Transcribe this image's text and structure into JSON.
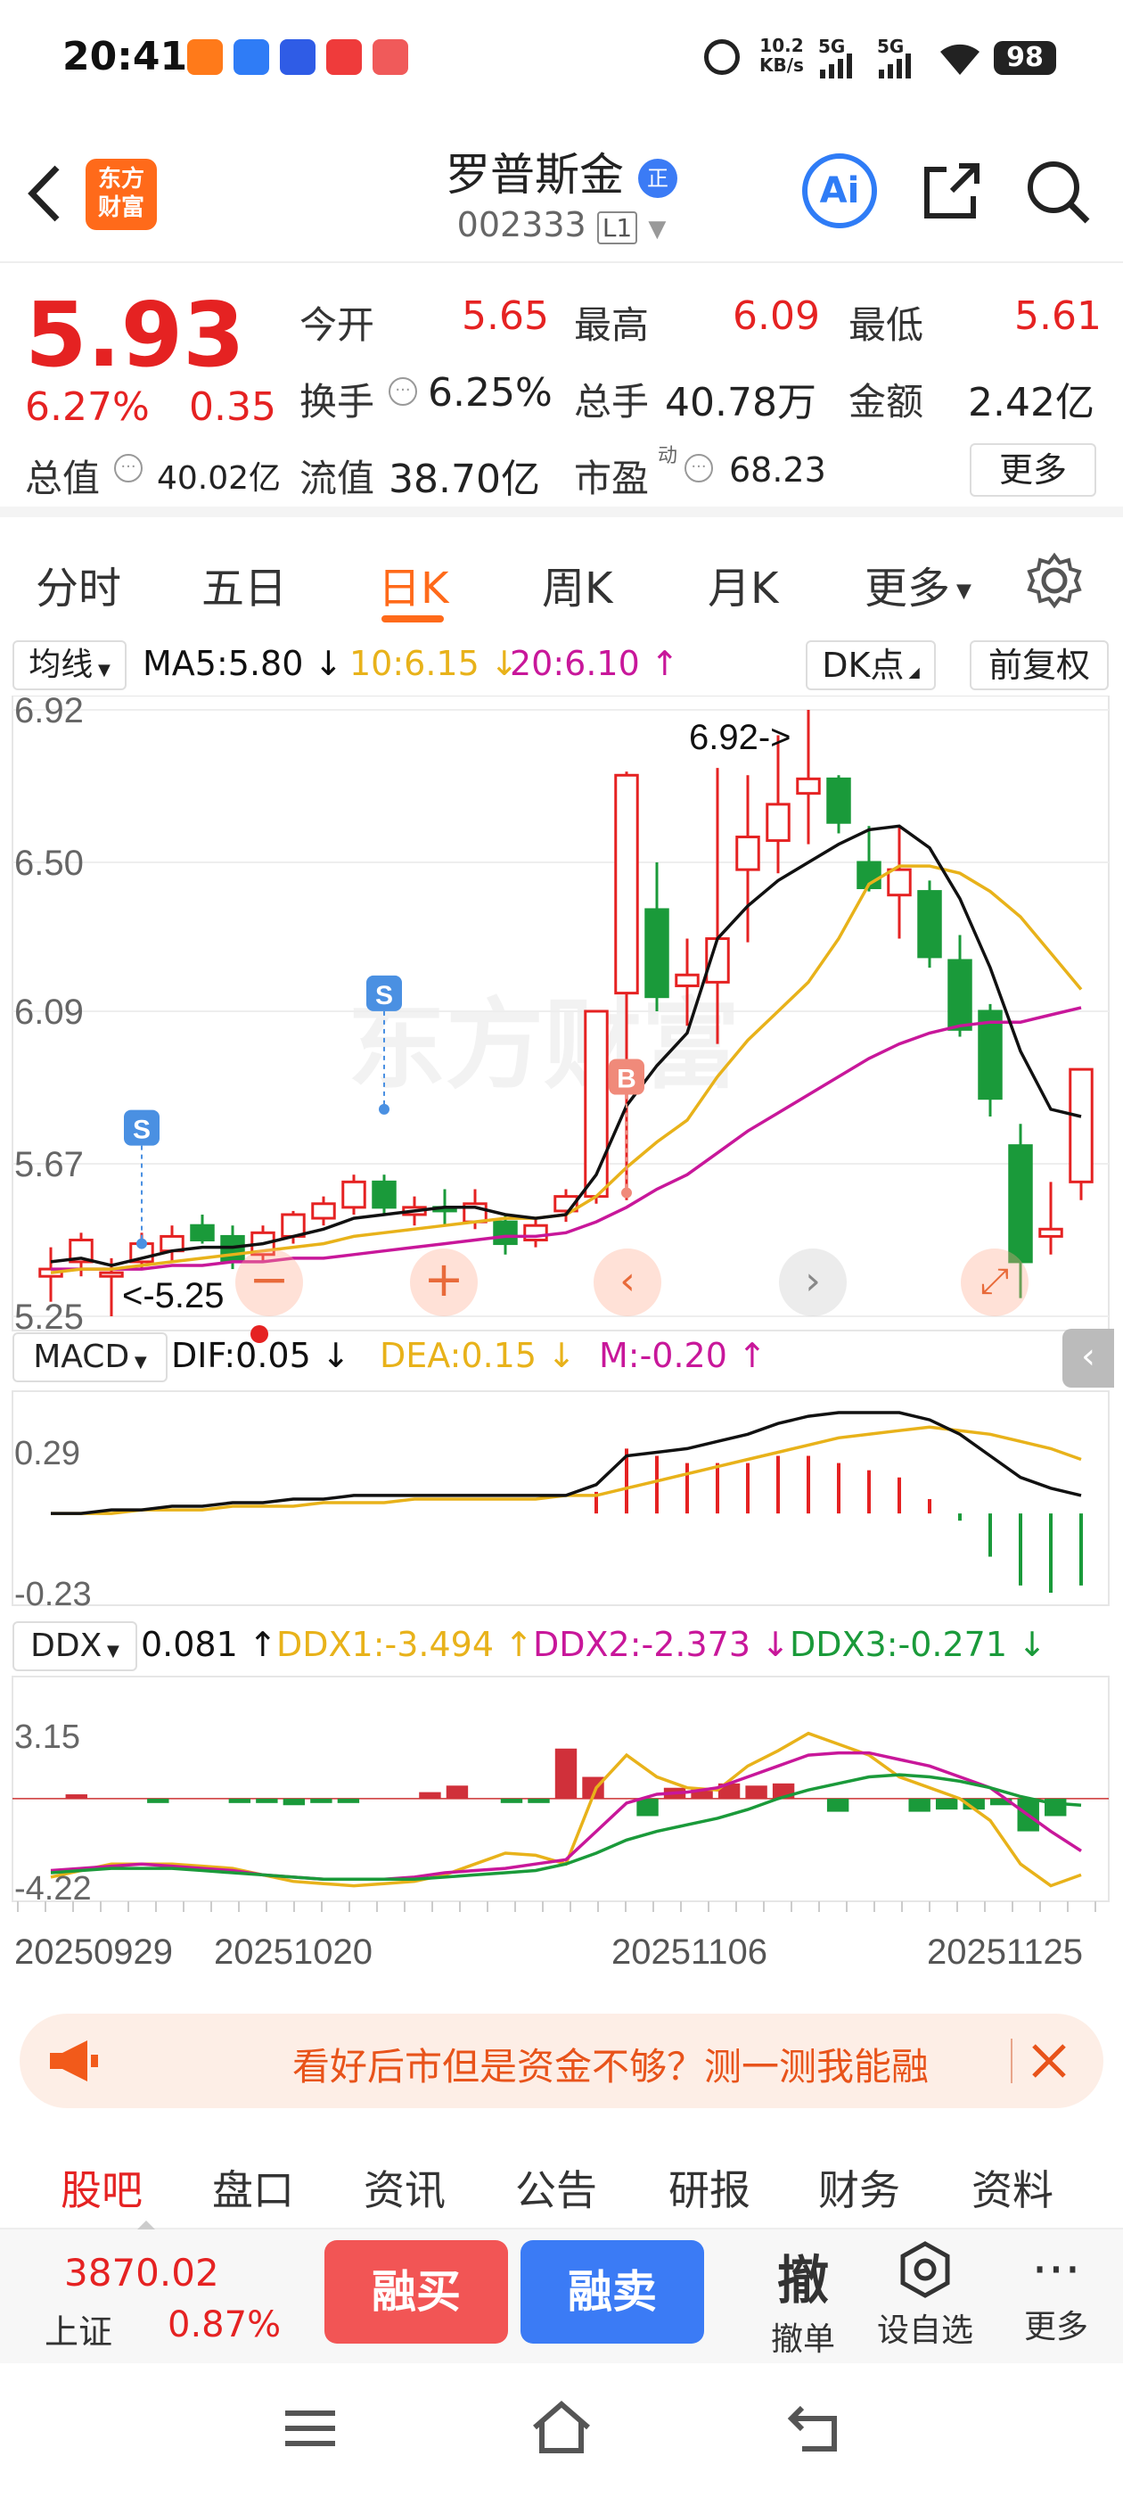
{
  "status_bar": {
    "time": "20:41",
    "network_speed_top": "10.2",
    "network_speed_unit": "KB/s",
    "signal1": "5G",
    "signal2": "5G",
    "battery": "98"
  },
  "header": {
    "logo_line1": "东方",
    "logo_line2": "财富",
    "stock_name": "罗普斯金",
    "badge": "正",
    "stock_code": "002333",
    "level": "L1",
    "ai_label": "Ai"
  },
  "quote": {
    "price": "5.93",
    "change_pct": "6.27%",
    "change_amt": "0.35",
    "open_label": "今开",
    "open": "5.65",
    "high_label": "最高",
    "high": "6.09",
    "low_label": "最低",
    "low": "5.61",
    "turnover_label": "换手",
    "turnover": "6.25%",
    "volume_label": "总手",
    "volume": "40.78万",
    "amount_label": "金额",
    "amount": "2.42亿",
    "mktcap_label": "总值",
    "mktcap": "40.02亿",
    "float_label": "流值",
    "float": "38.70亿",
    "pe_label": "市盈",
    "pe_sup": "动",
    "pe": "68.23",
    "more": "更多"
  },
  "period_tabs": [
    "分时",
    "五日",
    "日K",
    "周K",
    "月K",
    "更多"
  ],
  "active_tab": "日K",
  "kline": {
    "ma_label": "均线",
    "ma5": "MA5:5.80 ↓",
    "ma10": "10:6.15 ↓",
    "ma20": "20:6.10 ↑",
    "dk_btn": "DK点",
    "adjust_btn": "前复权",
    "y_labels": [
      "6.92",
      "6.50",
      "6.09",
      "5.67",
      "5.25"
    ],
    "max_annot": "6.92->",
    "min_annot": "<-5.25",
    "watermark": "东方财富",
    "signal_s": "S",
    "signal_b": "B"
  },
  "macd": {
    "label": "MACD",
    "dif": "DIF:0.05 ↓",
    "dea": "DEA:0.15 ↓",
    "m": "M:-0.20 ↑",
    "y_top": "0.29",
    "y_bottom": "-0.23"
  },
  "ddx": {
    "label": "DDX",
    "ddx": "0.081 ↑",
    "ddx1": "DDX1:-3.494 ↑",
    "ddx2": "DDX2:-2.373 ↓",
    "ddx3": "DDX3:-0.271 ↓",
    "y_top": "3.15",
    "y_bottom": "-4.22"
  },
  "dates": [
    "20250929",
    "20251020",
    "20251106",
    "20251125"
  ],
  "banner": {
    "text": "看好后市但是资金不够？测一测我能融"
  },
  "bottom_tabs": [
    "股吧",
    "盘口",
    "资讯",
    "公告",
    "研报",
    "财务",
    "资料"
  ],
  "active_bottom_tab": "股吧",
  "toolbar": {
    "index_value": "3870.02",
    "index_name": "上证",
    "index_change": "0.87%",
    "buy": "融买",
    "sell": "融卖",
    "cancel_icon_char": "撤",
    "cancel_label": "撤单",
    "watch_label": "设自选",
    "more_label": "更多"
  },
  "colors": {
    "up": "#e52222",
    "down": "#1a9a3a",
    "ma5": "#111111",
    "ma10": "#e8b21a",
    "ma20": "#c8179a",
    "accent": "#ff6a1a",
    "blue": "#3b7bf5"
  },
  "chart_data": {
    "type": "candlestick",
    "y_range": [
      5.25,
      6.92
    ],
    "candles": [
      {
        "o": 5.36,
        "h": 5.44,
        "l": 5.29,
        "c": 5.38
      },
      {
        "o": 5.4,
        "h": 5.48,
        "l": 5.36,
        "c": 5.46
      },
      {
        "o": 5.36,
        "h": 5.41,
        "l": 5.25,
        "c": 5.37
      },
      {
        "o": 5.4,
        "h": 5.48,
        "l": 5.38,
        "c": 5.45
      },
      {
        "o": 5.43,
        "h": 5.5,
        "l": 5.4,
        "c": 5.47
      },
      {
        "o": 5.5,
        "h": 5.53,
        "l": 5.45,
        "c": 5.46
      },
      {
        "o": 5.47,
        "h": 5.5,
        "l": 5.38,
        "c": 5.4
      },
      {
        "o": 5.42,
        "h": 5.5,
        "l": 5.4,
        "c": 5.48
      },
      {
        "o": 5.47,
        "h": 5.54,
        "l": 5.45,
        "c": 5.53
      },
      {
        "o": 5.52,
        "h": 5.58,
        "l": 5.5,
        "c": 5.56
      },
      {
        "o": 5.55,
        "h": 5.64,
        "l": 5.53,
        "c": 5.62
      },
      {
        "o": 5.62,
        "h": 5.64,
        "l": 5.53,
        "c": 5.55
      },
      {
        "o": 5.53,
        "h": 5.58,
        "l": 5.5,
        "c": 5.55
      },
      {
        "o": 5.55,
        "h": 5.6,
        "l": 5.5,
        "c": 5.54
      },
      {
        "o": 5.51,
        "h": 5.6,
        "l": 5.49,
        "c": 5.56
      },
      {
        "o": 5.51,
        "h": 5.53,
        "l": 5.42,
        "c": 5.45
      },
      {
        "o": 5.46,
        "h": 5.52,
        "l": 5.44,
        "c": 5.5
      },
      {
        "o": 5.54,
        "h": 5.6,
        "l": 5.51,
        "c": 5.58
      },
      {
        "o": 5.58,
        "h": 6.09,
        "l": 5.56,
        "c": 6.09
      },
      {
        "o": 6.14,
        "h": 6.75,
        "l": 5.57,
        "c": 6.74
      },
      {
        "o": 6.37,
        "h": 6.5,
        "l": 6.09,
        "c": 6.13
      },
      {
        "o": 6.16,
        "h": 6.29,
        "l": 6.05,
        "c": 6.19
      },
      {
        "o": 6.17,
        "h": 6.76,
        "l": 6.0,
        "c": 6.29
      },
      {
        "o": 6.48,
        "h": 6.74,
        "l": 6.28,
        "c": 6.57
      },
      {
        "o": 6.56,
        "h": 6.85,
        "l": 6.47,
        "c": 6.66
      },
      {
        "o": 6.69,
        "h": 6.92,
        "l": 6.55,
        "c": 6.73
      },
      {
        "o": 6.73,
        "h": 6.74,
        "l": 6.58,
        "c": 6.61
      },
      {
        "o": 6.5,
        "h": 6.6,
        "l": 6.42,
        "c": 6.43
      },
      {
        "o": 6.41,
        "h": 6.6,
        "l": 6.29,
        "c": 6.48
      },
      {
        "o": 6.42,
        "h": 6.45,
        "l": 6.21,
        "c": 6.24
      },
      {
        "o": 6.23,
        "h": 6.3,
        "l": 6.02,
        "c": 6.04
      },
      {
        "o": 6.09,
        "h": 6.11,
        "l": 5.8,
        "c": 5.85
      },
      {
        "o": 5.72,
        "h": 5.78,
        "l": 5.3,
        "c": 5.4
      },
      {
        "o": 5.47,
        "h": 5.62,
        "l": 5.42,
        "c": 5.49
      },
      {
        "o": 5.62,
        "h": 5.82,
        "l": 5.57,
        "c": 5.93
      }
    ],
    "ma5": [
      5.4,
      5.41,
      5.39,
      5.41,
      5.43,
      5.44,
      5.44,
      5.45,
      5.47,
      5.49,
      5.52,
      5.53,
      5.54,
      5.55,
      5.55,
      5.53,
      5.52,
      5.53,
      5.64,
      5.83,
      5.94,
      6.03,
      6.29,
      6.38,
      6.45,
      6.5,
      6.55,
      6.59,
      6.6,
      6.54,
      6.4,
      6.21,
      5.98,
      5.82,
      5.8
    ],
    "ma10": [
      5.37,
      5.38,
      5.38,
      5.39,
      5.4,
      5.41,
      5.42,
      5.43,
      5.44,
      5.45,
      5.47,
      5.48,
      5.49,
      5.5,
      5.51,
      5.52,
      5.52,
      5.53,
      5.58,
      5.66,
      5.73,
      5.79,
      5.91,
      6.01,
      6.09,
      6.17,
      6.29,
      6.44,
      6.49,
      6.49,
      6.47,
      6.42,
      6.35,
      6.25,
      6.15
    ],
    "ma20": [
      5.38,
      5.38,
      5.38,
      5.38,
      5.39,
      5.39,
      5.4,
      5.4,
      5.41,
      5.41,
      5.42,
      5.43,
      5.44,
      5.45,
      5.46,
      5.47,
      5.47,
      5.48,
      5.51,
      5.55,
      5.6,
      5.64,
      5.7,
      5.76,
      5.81,
      5.86,
      5.91,
      5.96,
      6.0,
      6.03,
      6.05,
      6.06,
      6.06,
      6.08,
      6.1
    ],
    "macd_range": [
      -0.23,
      0.29
    ],
    "dif": [
      0.0,
      0.0,
      0.01,
      0.01,
      0.02,
      0.02,
      0.03,
      0.03,
      0.04,
      0.04,
      0.05,
      0.05,
      0.05,
      0.05,
      0.05,
      0.05,
      0.05,
      0.05,
      0.08,
      0.16,
      0.17,
      0.18,
      0.2,
      0.22,
      0.25,
      0.27,
      0.28,
      0.28,
      0.28,
      0.26,
      0.22,
      0.16,
      0.1,
      0.07,
      0.05
    ],
    "dea": [
      0.0,
      0.0,
      0.0,
      0.01,
      0.01,
      0.01,
      0.02,
      0.02,
      0.02,
      0.03,
      0.03,
      0.03,
      0.04,
      0.04,
      0.04,
      0.04,
      0.04,
      0.05,
      0.05,
      0.07,
      0.09,
      0.11,
      0.13,
      0.15,
      0.17,
      0.19,
      0.21,
      0.22,
      0.23,
      0.24,
      0.23,
      0.22,
      0.2,
      0.18,
      0.15
    ],
    "m": [
      0.0,
      0.0,
      0.0,
      0.0,
      0.0,
      0.0,
      0.0,
      0.0,
      0.0,
      0.0,
      0.0,
      0.0,
      0.0,
      0.0,
      0.0,
      0.0,
      0.0,
      0.0,
      0.06,
      0.18,
      0.16,
      0.14,
      0.14,
      0.14,
      0.16,
      0.16,
      0.14,
      0.12,
      0.1,
      0.04,
      -0.02,
      -0.12,
      -0.2,
      -0.22,
      -0.2
    ],
    "ddx_range": [
      -4.22,
      3.15
    ],
    "ddx_bars": [
      0.0,
      0.2,
      0.0,
      0.0,
      -0.2,
      0.0,
      0.0,
      -0.2,
      -0.2,
      -0.3,
      -0.2,
      -0.2,
      0.0,
      0.0,
      0.3,
      0.6,
      0.0,
      -0.2,
      -0.2,
      2.3,
      1.0,
      0.0,
      -0.8,
      0.5,
      0.5,
      0.7,
      0.6,
      0.7,
      0.0,
      -0.6,
      0.0,
      0.0,
      -0.6,
      -0.5,
      -0.5,
      -0.3,
      -1.5,
      -0.8,
      0.0
    ],
    "ddx1": [
      -3.6,
      -3.3,
      -3.0,
      -3.0,
      -3.0,
      -3.1,
      -3.2,
      -3.5,
      -3.8,
      -3.9,
      -4.0,
      -3.9,
      -3.8,
      -3.5,
      -3.0,
      -2.5,
      -2.6,
      -3.0,
      0.5,
      2.0,
      1.0,
      0.5,
      0.4,
      1.5,
      2.2,
      3.0,
      2.5,
      2.0,
      1.0,
      0.5,
      0.0,
      -1.0,
      -3.0,
      -4.0,
      -3.5
    ],
    "ddx2": [
      -3.3,
      -3.2,
      -3.1,
      -3.0,
      -3.1,
      -3.2,
      -3.3,
      -3.5,
      -3.6,
      -3.7,
      -3.7,
      -3.7,
      -3.6,
      -3.4,
      -3.3,
      -3.2,
      -3.0,
      -2.8,
      -1.5,
      -0.2,
      0.2,
      0.3,
      0.5,
      1.0,
      1.5,
      2.0,
      2.1,
      2.1,
      1.8,
      1.5,
      1.0,
      0.5,
      -0.5,
      -1.5,
      -2.4
    ],
    "ddx3": [
      -3.4,
      -3.3,
      -3.2,
      -3.2,
      -3.2,
      -3.3,
      -3.4,
      -3.5,
      -3.6,
      -3.7,
      -3.7,
      -3.7,
      -3.7,
      -3.6,
      -3.5,
      -3.4,
      -3.3,
      -3.0,
      -2.5,
      -1.9,
      -1.5,
      -1.2,
      -0.9,
      -0.5,
      0.0,
      0.4,
      0.7,
      1.0,
      1.1,
      1.0,
      0.8,
      0.5,
      0.1,
      -0.2,
      -0.3
    ]
  }
}
